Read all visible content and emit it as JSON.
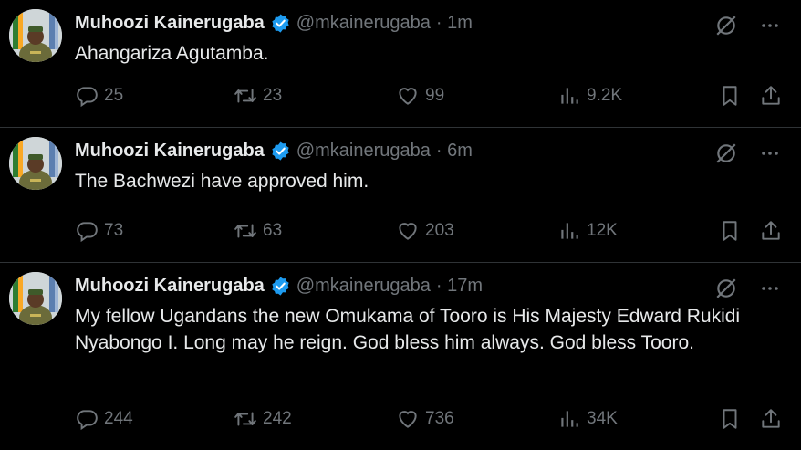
{
  "tweets": [
    {
      "author": "Muhoozi Kainerugaba",
      "handle": "@mkainerugaba",
      "time": "· 1m",
      "text": "Ahangariza Agutamba.",
      "replies": "25",
      "retweets": "23",
      "likes": "99",
      "views": "9.2K"
    },
    {
      "author": "Muhoozi Kainerugaba",
      "handle": "@mkainerugaba",
      "time": "· 6m",
      "text": "The Bachwezi have approved him.",
      "replies": "73",
      "retweets": "63",
      "likes": "203",
      "views": "12K"
    },
    {
      "author": "Muhoozi Kainerugaba",
      "handle": "@mkainerugaba",
      "time": "· 17m",
      "text": "My fellow Ugandans the new Omukama of Tooro is His Majesty Edward Rukidi Nyabongo I. Long may he reign. God bless him always. God bless Tooro.",
      "replies": "244",
      "retweets": "242",
      "likes": "736",
      "views": "34K"
    }
  ],
  "icons": {
    "verified": "verified-badge-icon",
    "grok": "grok-icon",
    "more": "more-icon",
    "reply": "reply-icon",
    "retweet": "retweet-icon",
    "like": "heart-icon",
    "views": "views-icon",
    "bookmark": "bookmark-icon",
    "share": "share-icon"
  },
  "colors": {
    "background": "#000000",
    "text": "#e7e9ea",
    "muted": "#71767b",
    "verified": "#1d9bf0",
    "divider": "#2f3336"
  }
}
